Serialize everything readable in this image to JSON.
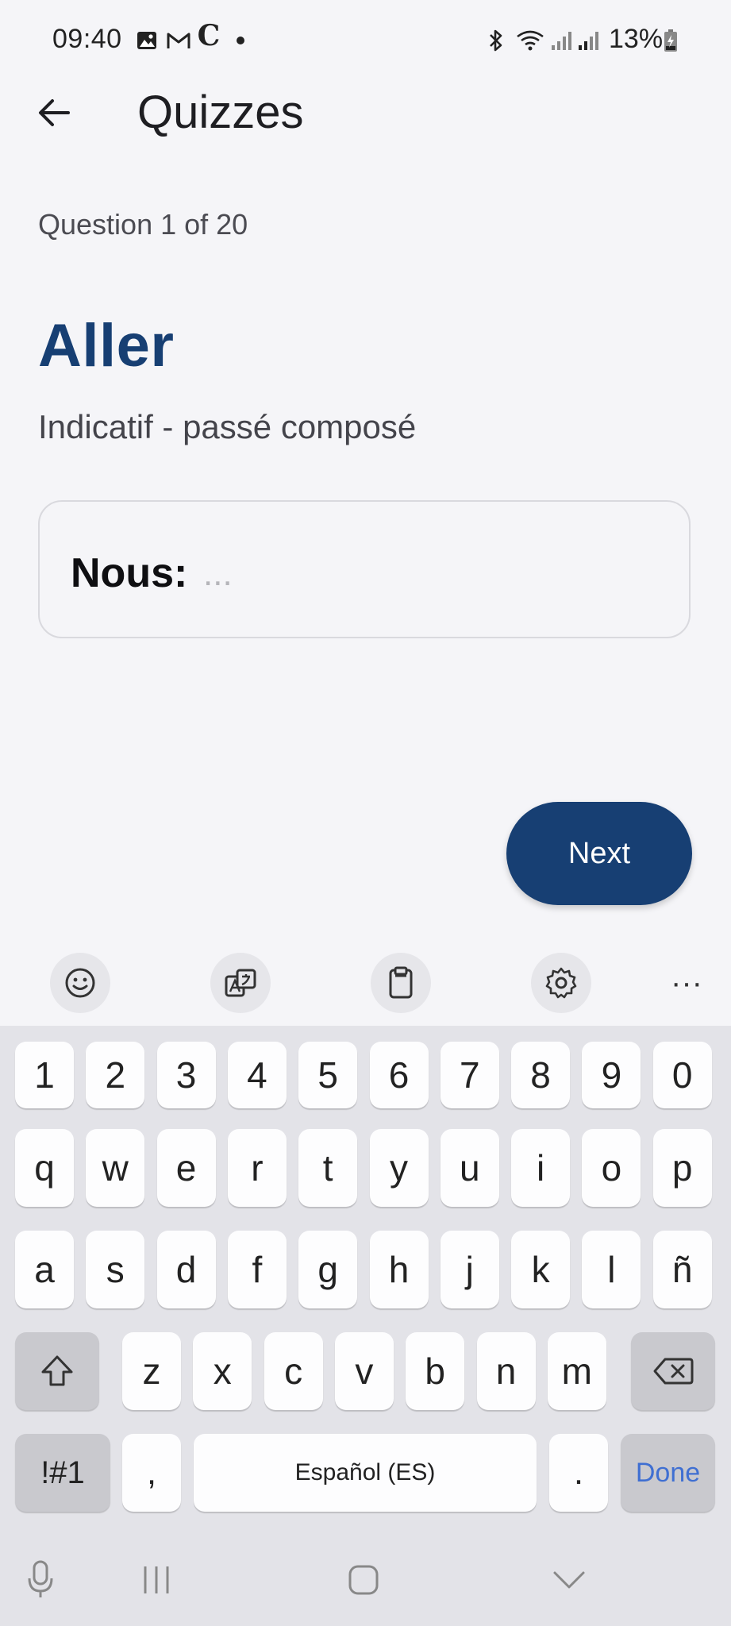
{
  "status_bar": {
    "time": "09:40",
    "battery": "13%",
    "icons": [
      "gallery-icon",
      "gmail-icon",
      "c-app-icon",
      "notification-dot-icon",
      "bluetooth-icon",
      "wifi-icon",
      "signal-icon",
      "signal-icon",
      "battery-charging-icon"
    ]
  },
  "app_bar": {
    "back_icon": "arrow-back-icon",
    "title": "Quizzes"
  },
  "quiz": {
    "progress": "Question 1 of 20",
    "verb": "Aller",
    "tense": "Indicatif - passé composé",
    "pronoun": "Nous:",
    "answer_value": "",
    "answer_placeholder": "...",
    "next_label": "Next"
  },
  "keyboard_toolbar": {
    "items": [
      "emoji-icon",
      "translate-icon",
      "clipboard-icon",
      "settings-icon",
      "more-icon"
    ],
    "more_label": "···"
  },
  "keyboard": {
    "row_numbers": [
      "1",
      "2",
      "3",
      "4",
      "5",
      "6",
      "7",
      "8",
      "9",
      "0"
    ],
    "row_top": [
      "q",
      "w",
      "e",
      "r",
      "t",
      "y",
      "u",
      "i",
      "o",
      "p"
    ],
    "row_middle": [
      "a",
      "s",
      "d",
      "f",
      "g",
      "h",
      "j",
      "k",
      "l",
      "ñ"
    ],
    "row_bottom": [
      "z",
      "x",
      "c",
      "v",
      "b",
      "n",
      "m"
    ],
    "symbols_label": "!#1",
    "comma_label": ",",
    "space_label": "Español (ES)",
    "period_label": ".",
    "done_label": "Done"
  },
  "nav_bar": {
    "items": [
      "microphone-icon",
      "recent-apps-icon",
      "home-icon",
      "hide-keyboard-icon"
    ]
  },
  "colors": {
    "accent": "#173f73",
    "background": "#f5f5f8",
    "keyboard_bg": "#e3e3e8",
    "done_text": "#3f6fd2"
  }
}
